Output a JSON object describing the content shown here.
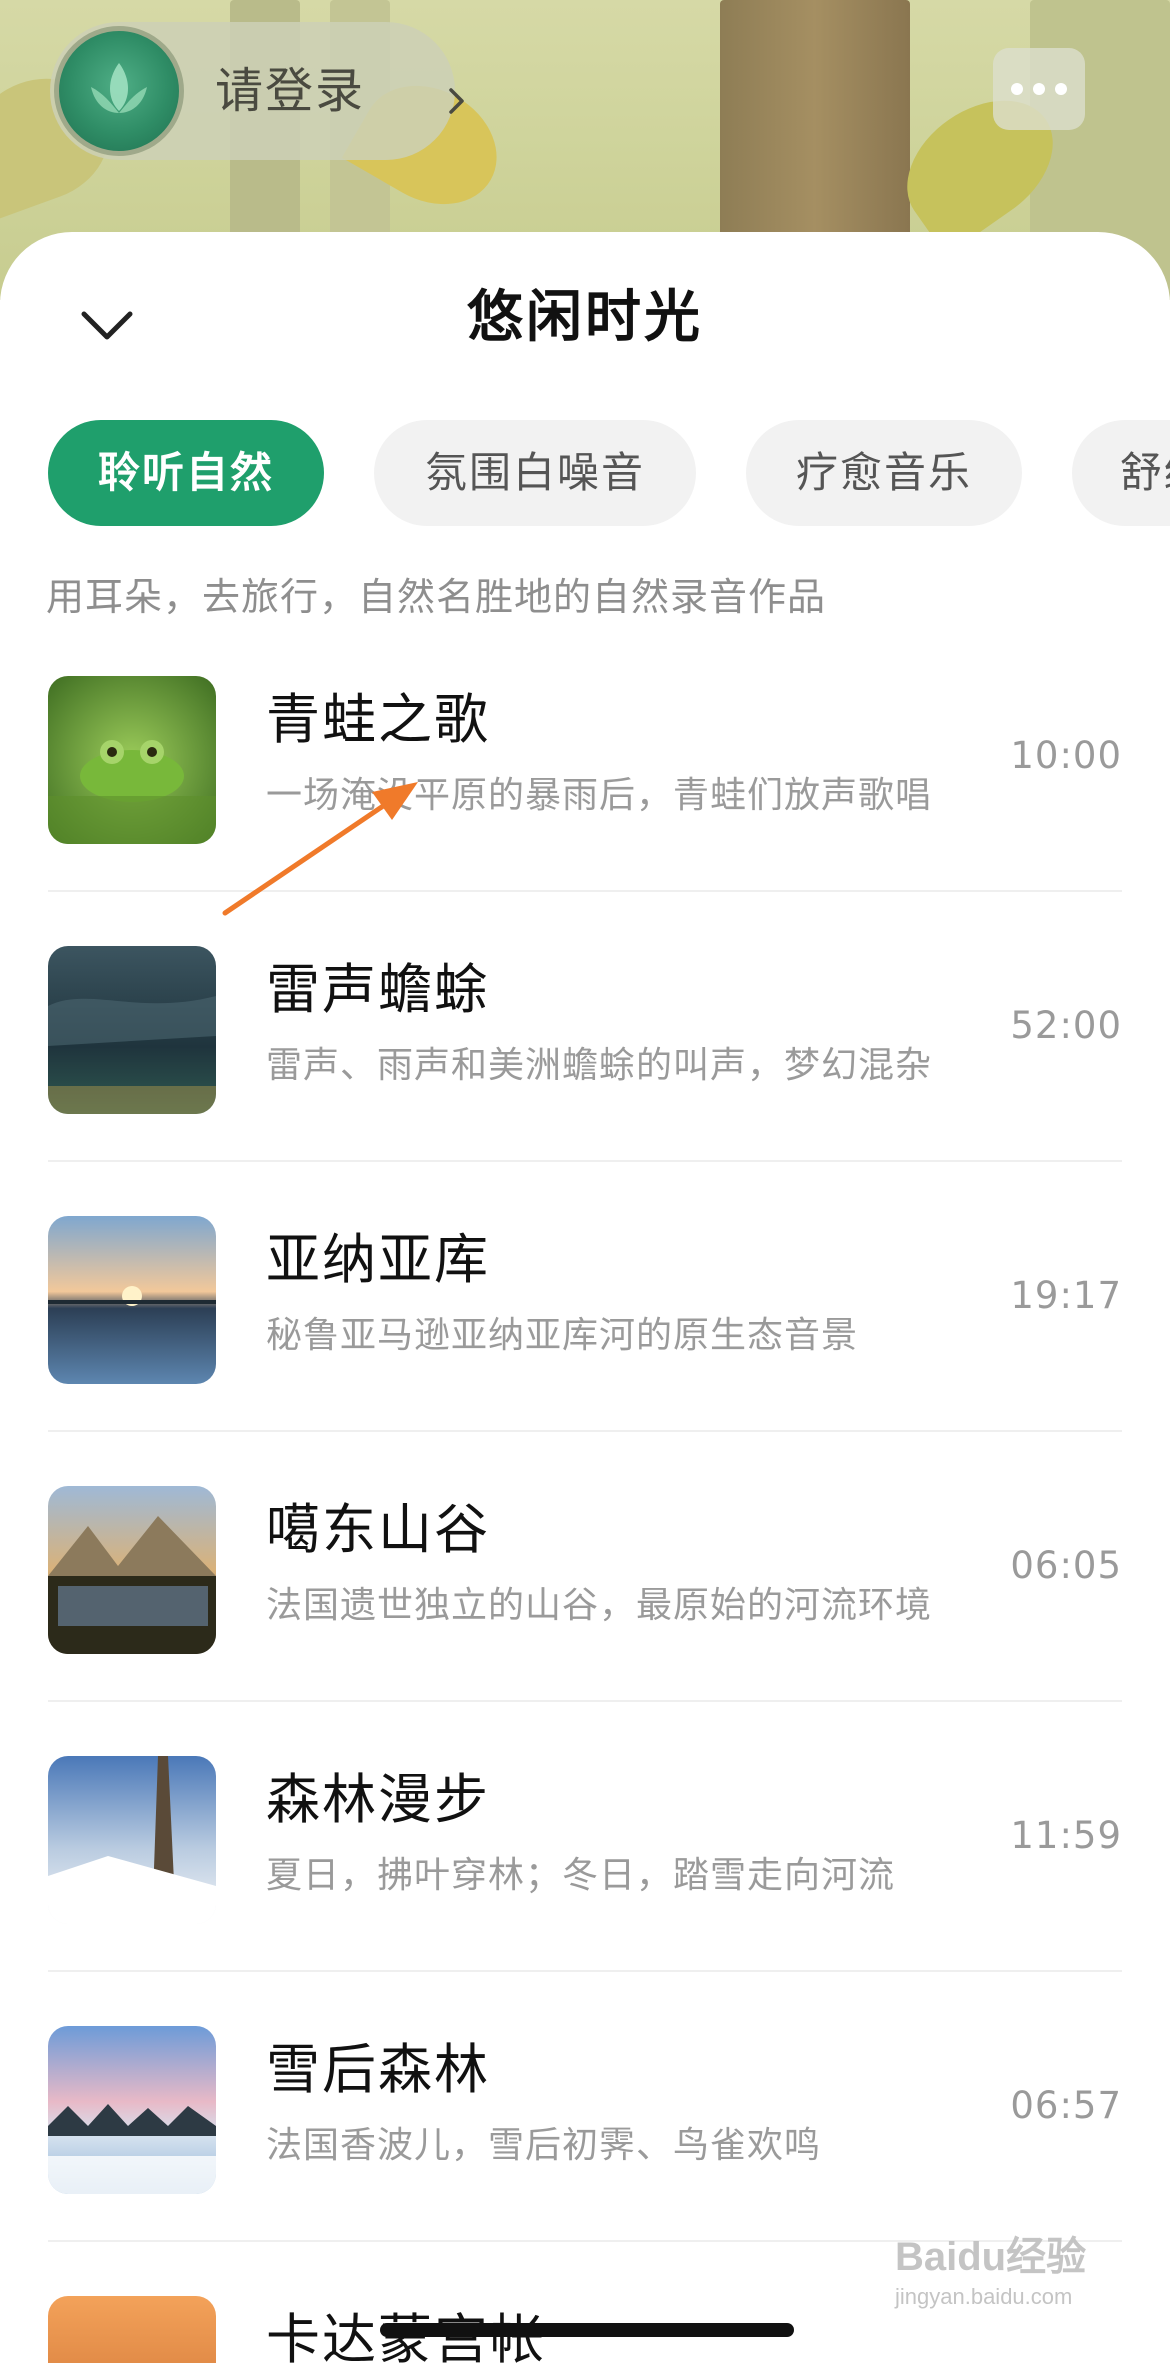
{
  "header": {
    "login_label": "请登录",
    "avatar_icon": "lotus-logo-icon",
    "chevron_icon": "chevron-right-icon",
    "message_icon": "chat-bubble-icon"
  },
  "sheet": {
    "title": "悠闲时光",
    "collapse_icon": "chevron-down-icon",
    "tabs": [
      {
        "label": "聆听自然",
        "active": true
      },
      {
        "label": "氛围白噪音",
        "active": false
      },
      {
        "label": "疗愈音乐",
        "active": false
      },
      {
        "label": "舒缓",
        "active": false
      }
    ],
    "subtitle": "用耳朵，去旅行，自然名胜地的自然录音作品",
    "tracks": [
      {
        "title": "青蛙之歌",
        "desc": "一场淹没平原的暴雨后，青蛙们放声歌唱",
        "duration": "10:00"
      },
      {
        "title": "雷声蟾蜍",
        "desc": "雷声、雨声和美洲蟾蜍的叫声，梦幻混杂",
        "duration": "52:00"
      },
      {
        "title": "亚纳亚库",
        "desc": "秘鲁亚马逊亚纳亚库河的原生态音景",
        "duration": "19:17"
      },
      {
        "title": "噶东山谷",
        "desc": "法国遗世独立的山谷，最原始的河流环境",
        "duration": "06:05"
      },
      {
        "title": "森林漫步",
        "desc": "夏日，拂叶穿林；冬日，踏雪走向河流",
        "duration": "11:59"
      },
      {
        "title": "雪后森林",
        "desc": "法国香波儿，雪后初霁、鸟雀欢鸣",
        "duration": "06:57"
      },
      {
        "title": "卡达蒙宫帐",
        "desc": "",
        "duration": ""
      }
    ]
  },
  "accent_color": "#1f9f6c",
  "watermark": {
    "top": "Baidu经验",
    "bottom": "jingyan.baidu.com"
  }
}
